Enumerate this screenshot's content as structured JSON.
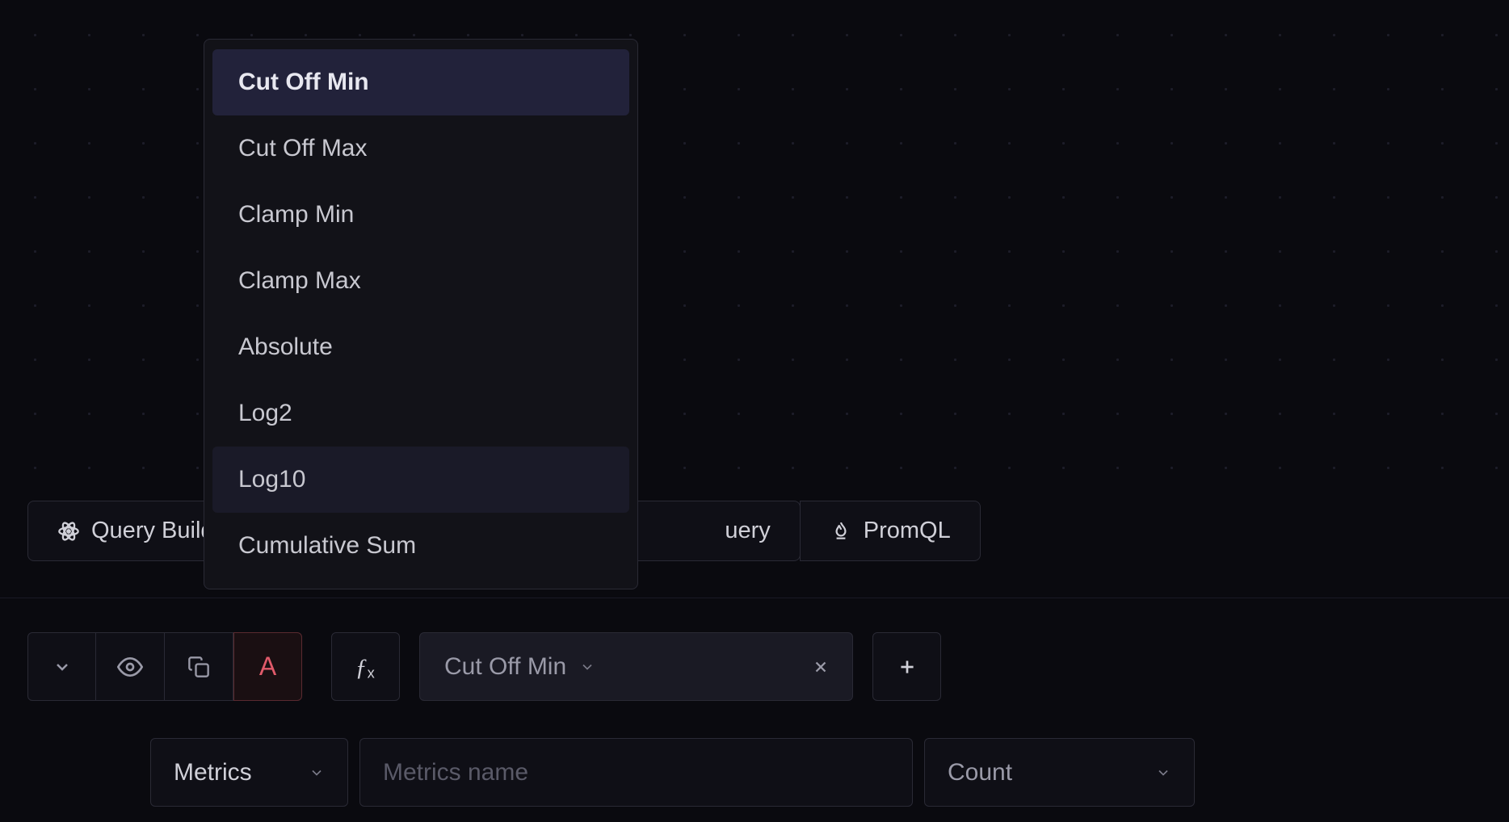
{
  "dropdown": {
    "items": [
      {
        "label": "Cut Off Min",
        "selected": true,
        "hovered": false
      },
      {
        "label": "Cut Off Max",
        "selected": false,
        "hovered": false
      },
      {
        "label": "Clamp Min",
        "selected": false,
        "hovered": false
      },
      {
        "label": "Clamp Max",
        "selected": false,
        "hovered": false
      },
      {
        "label": "Absolute",
        "selected": false,
        "hovered": false
      },
      {
        "label": "Log2",
        "selected": false,
        "hovered": false
      },
      {
        "label": "Log10",
        "selected": false,
        "hovered": true
      },
      {
        "label": "Cumulative Sum",
        "selected": false,
        "hovered": false
      }
    ]
  },
  "tabs": {
    "query_builder": "Query Builder",
    "clickhouse_query": "ClickHouse Query",
    "promql": "PromQL"
  },
  "toolbar": {
    "letter": "A"
  },
  "function_pill": {
    "label": "Cut Off Min"
  },
  "metrics_row": {
    "source_label": "Metrics",
    "name_placeholder": "Metrics name",
    "aggregation_label": "Count"
  }
}
